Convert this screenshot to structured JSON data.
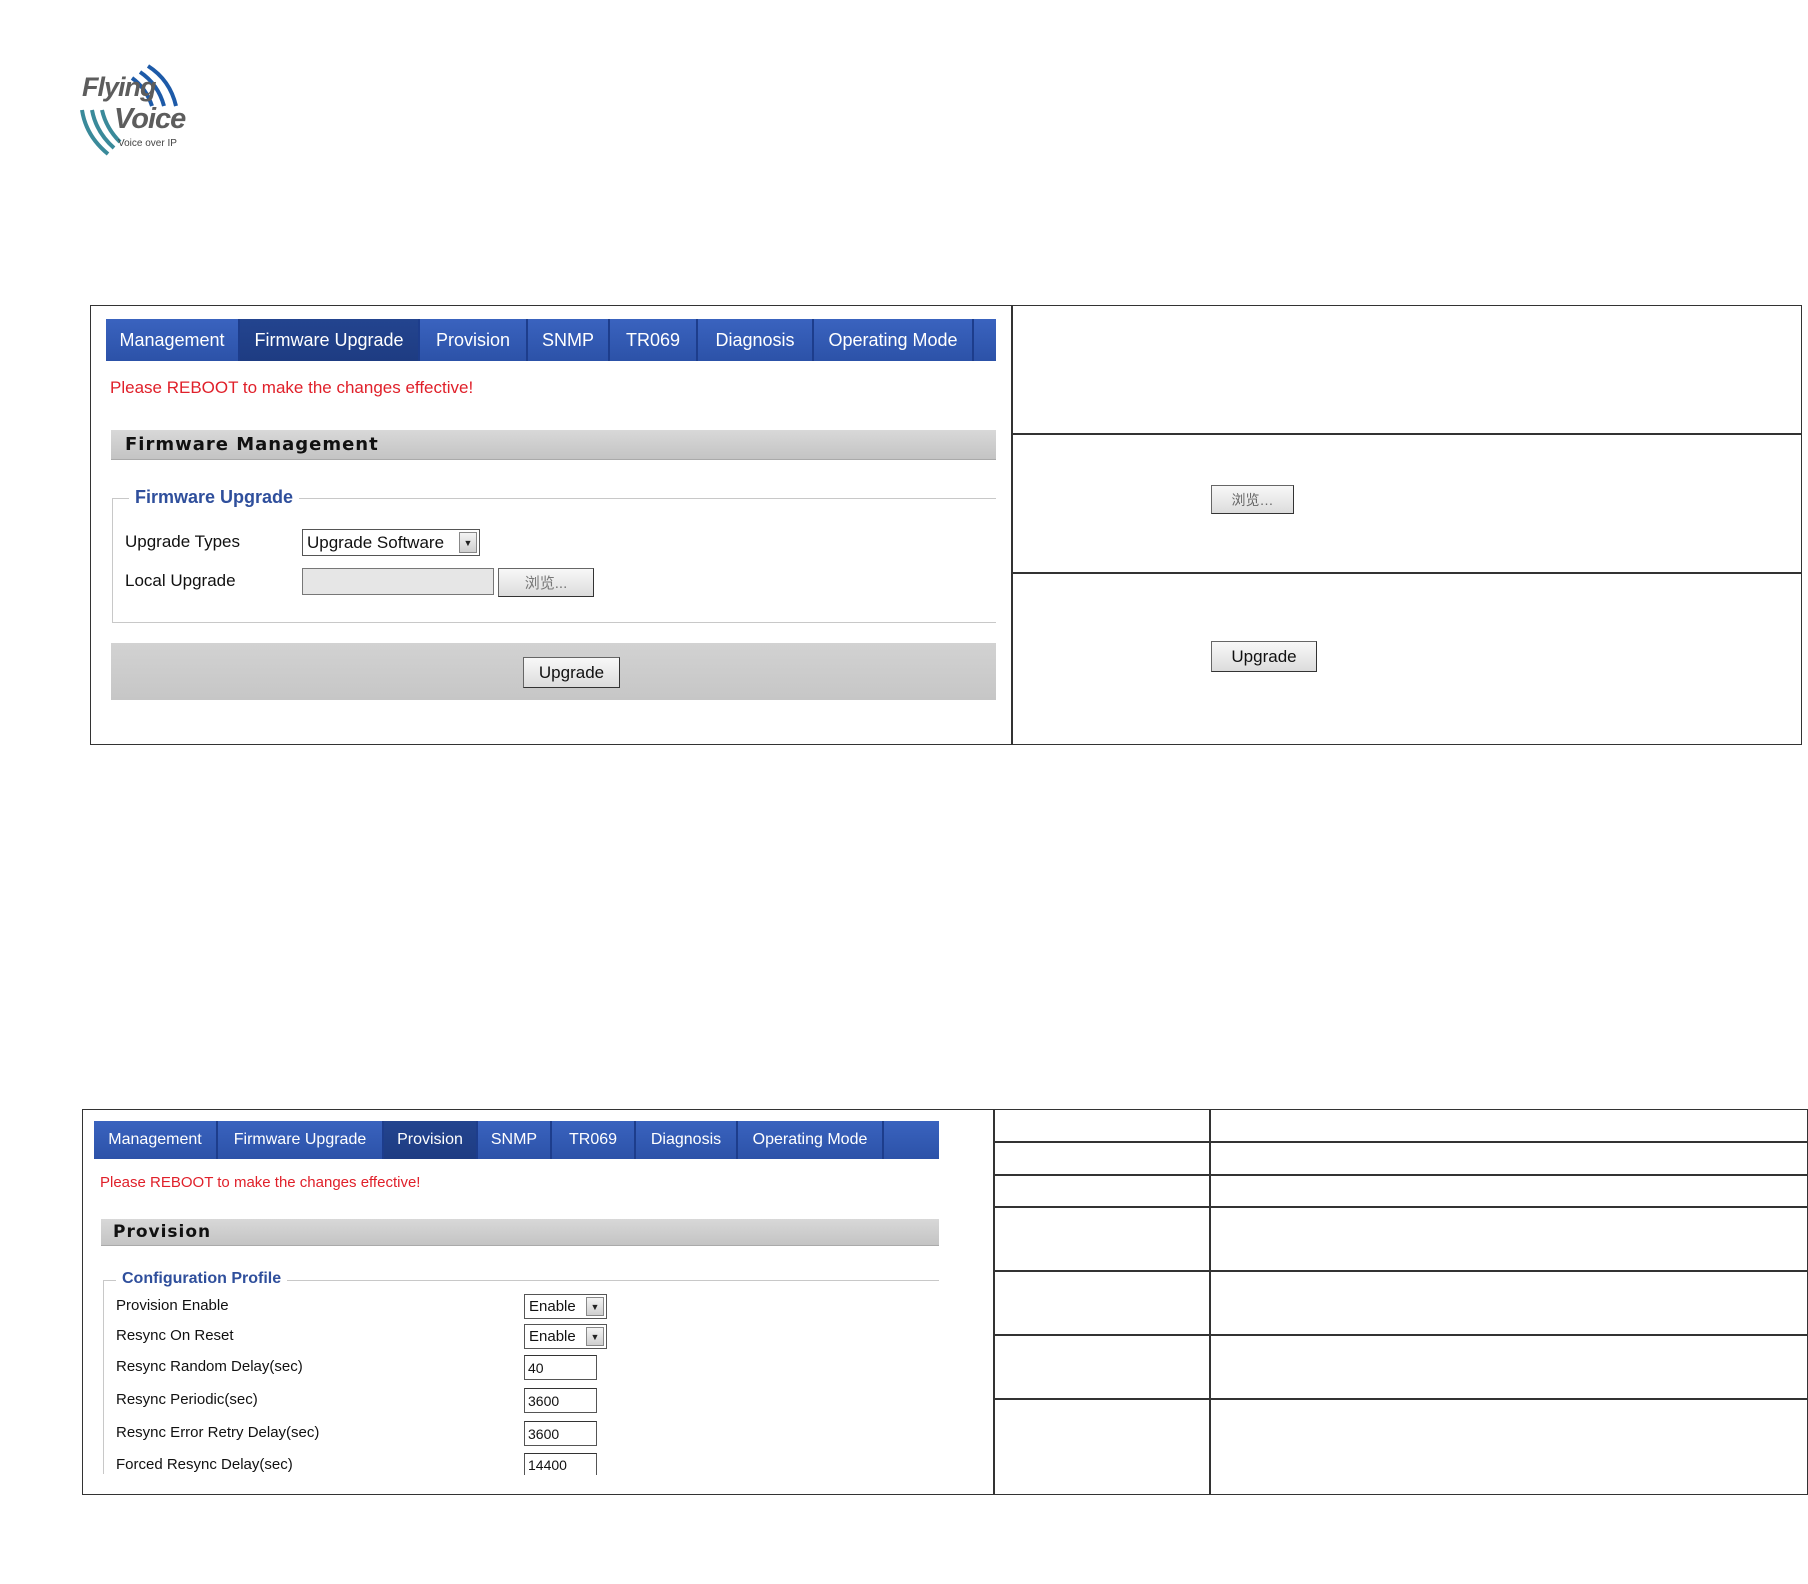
{
  "logo": {
    "line1": "Flying",
    "line2": "Voice",
    "tagline": "Voice over IP"
  },
  "top_panel": {
    "tabs": [
      "Management",
      "Firmware Upgrade",
      "Provision",
      "SNMP",
      "TR069",
      "Diagnosis",
      "Operating Mode"
    ],
    "active_tab": "Firmware Upgrade",
    "notice": "Please REBOOT to make the changes effective!",
    "section_title": "Firmware Management",
    "fieldset_legend": "Firmware Upgrade",
    "upgrade_types_label": "Upgrade Types",
    "upgrade_types_value": "Upgrade Software",
    "local_upgrade_label": "Local Upgrade",
    "browse_label": "浏览...",
    "upgrade_button": "Upgrade",
    "side_browse_label": "浏览…",
    "side_upgrade_label": "Upgrade"
  },
  "bottom_panel": {
    "tabs": [
      "Management",
      "Firmware Upgrade",
      "Provision",
      "SNMP",
      "TR069",
      "Diagnosis",
      "Operating Mode"
    ],
    "active_tab": "Provision",
    "notice": "Please REBOOT to make the changes effective!",
    "section_title": "Provision",
    "fieldset_legend": "Configuration Profile",
    "fields": [
      {
        "label": "Provision Enable",
        "type": "select",
        "value": "Enable"
      },
      {
        "label": "Resync On Reset",
        "type": "select",
        "value": "Enable"
      },
      {
        "label": "Resync Random Delay(sec)",
        "type": "text",
        "value": "40"
      },
      {
        "label": "Resync Periodic(sec)",
        "type": "text",
        "value": "3600"
      },
      {
        "label": "Resync Error Retry Delay(sec)",
        "type": "text",
        "value": "3600"
      },
      {
        "label": "Forced Resync Delay(sec)",
        "type": "text",
        "value": "14400"
      }
    ]
  },
  "colors": {
    "tab_blue": "#2f56b0",
    "notice_red": "#e0202a",
    "legend_blue": "#2f4f9c"
  }
}
